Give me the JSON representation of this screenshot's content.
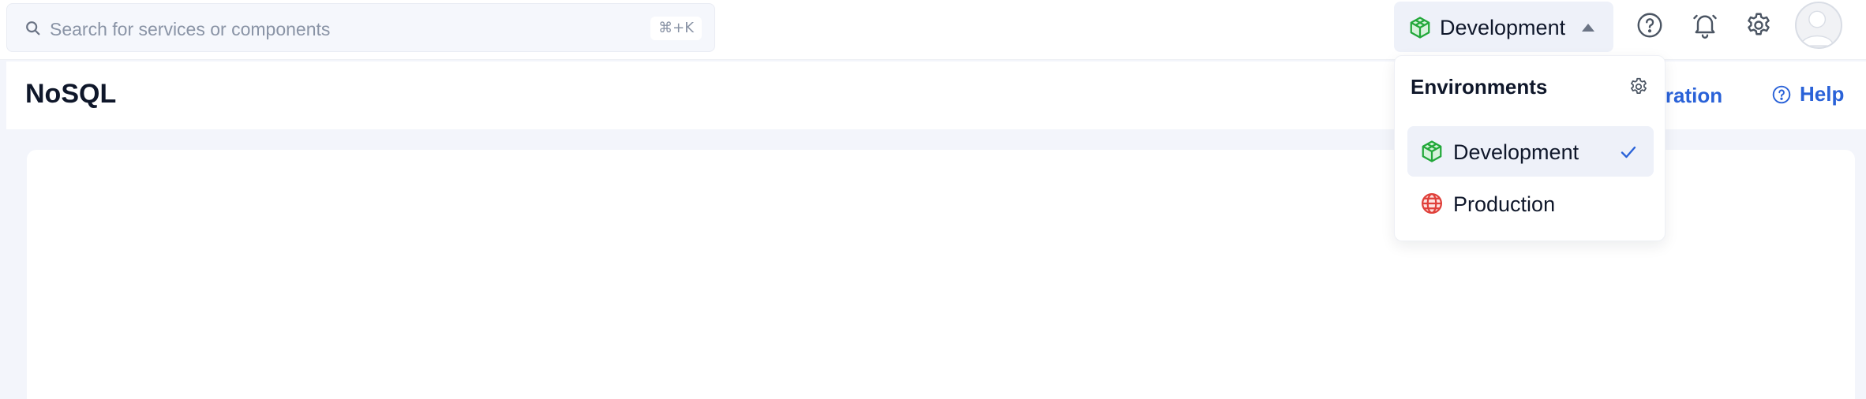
{
  "search": {
    "placeholder": "Search for services or components",
    "shortcut": "⌘+K"
  },
  "environment": {
    "current": "Development",
    "accent": "#22a83a"
  },
  "header": {
    "title": "NoSQL",
    "partial_link": "gration",
    "help_label": "Help",
    "link_color": "#2a62d8"
  },
  "dropdown": {
    "title": "Environments",
    "items": [
      {
        "label": "Development",
        "icon": "cube-icon",
        "color": "#22a83a",
        "selected": true
      },
      {
        "label": "Production",
        "icon": "globe-icon",
        "color": "#e0403a",
        "selected": false
      }
    ]
  },
  "icons": {
    "search": "search-icon",
    "help": "help-circle-icon",
    "notifications": "bell-icon",
    "settings": "gear-icon",
    "avatar": "user-avatar"
  }
}
